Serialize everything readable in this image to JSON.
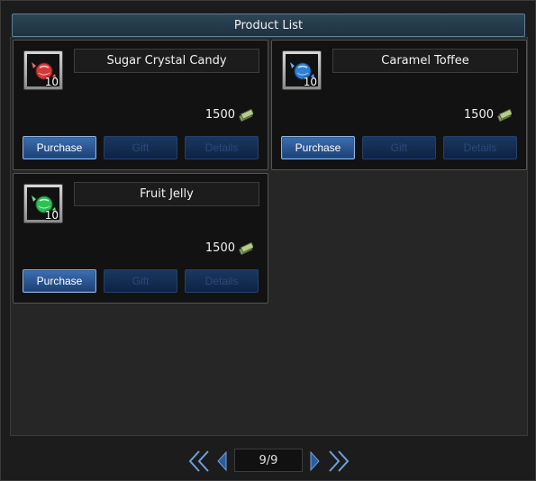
{
  "window": {
    "title": "Product List"
  },
  "products": [
    {
      "name": "Sugar Crystal Candy",
      "quantity": "10",
      "price": "1500",
      "icon": "red-candy-icon",
      "icon_color": "#d23a3a",
      "buttons": {
        "purchase": "Purchase",
        "gift": "Gift",
        "details": "Details"
      }
    },
    {
      "name": "Caramel Toffee",
      "quantity": "10",
      "price": "1500",
      "icon": "blue-candy-icon",
      "icon_color": "#2f7fd6",
      "buttons": {
        "purchase": "Purchase",
        "gift": "Gift",
        "details": "Details"
      }
    },
    {
      "name": "Fruit Jelly",
      "quantity": "10",
      "price": "1500",
      "icon": "green-candy-icon",
      "icon_color": "#2fbf55",
      "buttons": {
        "purchase": "Purchase",
        "gift": "Gift",
        "details": "Details"
      }
    }
  ],
  "currency_icon": "money-icon",
  "pagination": {
    "current": "9/9"
  },
  "colors": {
    "accent": "#3e6fb0",
    "title_bar": "#2c4656"
  }
}
